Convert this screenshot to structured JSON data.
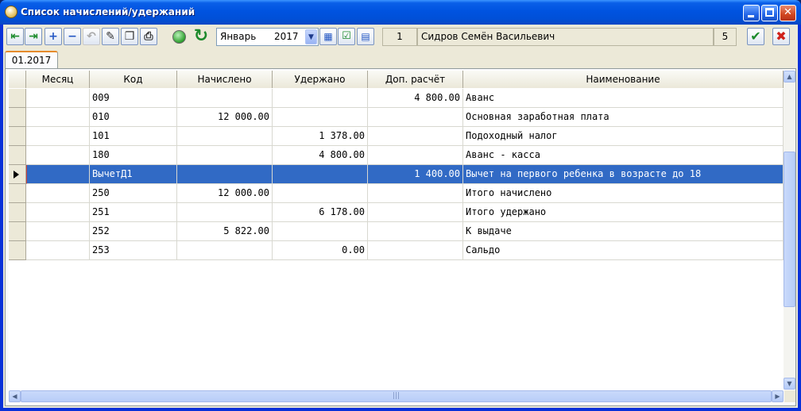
{
  "window": {
    "title": "Список начислений/удержаний"
  },
  "toolbar": {
    "period_month": "Январь",
    "period_year": "2017",
    "employee_number": "1",
    "employee_name": "Сидров Семён Васильевич",
    "employee_count": "5"
  },
  "tabs": [
    {
      "label": "01.2017"
    }
  ],
  "grid": {
    "columns": [
      "Месяц",
      "Код",
      "Начислено",
      "Удержано",
      "Доп. расчёт",
      "Наименование"
    ],
    "selected_row": 4,
    "rows": [
      {
        "month": "",
        "code": "009",
        "accrued": "",
        "withheld": "",
        "extra": "4 800.00",
        "name": "Аванс"
      },
      {
        "month": "",
        "code": "010",
        "accrued": "12 000.00",
        "withheld": "",
        "extra": "",
        "name": "Основная заработная плата"
      },
      {
        "month": "",
        "code": "101",
        "accrued": "",
        "withheld": "1 378.00",
        "extra": "",
        "name": "Подоходный налог"
      },
      {
        "month": "",
        "code": "180",
        "accrued": "",
        "withheld": "4 800.00",
        "extra": "",
        "name": "Аванс - касса"
      },
      {
        "month": "",
        "code": "ВычетД1",
        "accrued": "",
        "withheld": "",
        "extra": "1 400.00",
        "name": "Вычет на первого ребенка в возрасте до 18"
      },
      {
        "month": "",
        "code": "250",
        "accrued": "12 000.00",
        "withheld": "",
        "extra": "",
        "name": "Итого начислено"
      },
      {
        "month": "",
        "code": "251",
        "accrued": "",
        "withheld": "6 178.00",
        "extra": "",
        "name": "Итого удержано"
      },
      {
        "month": "",
        "code": "252",
        "accrued": "5 822.00",
        "withheld": "",
        "extra": "",
        "name": "К выдаче"
      },
      {
        "month": "",
        "code": "253",
        "accrued": "",
        "withheld": "0.00",
        "extra": "",
        "name": "Сальдо"
      }
    ]
  },
  "icons": {
    "first": "arrow-left-icon",
    "next": "arrow-right-icon",
    "add": "plus-icon",
    "remove": "minus-icon",
    "undo": "undo-icon",
    "edit": "pencil-icon",
    "copy": "copy-icon",
    "print": "printer-icon",
    "status": "green-circle-icon",
    "refresh": "refresh-icon",
    "calendar": "calendar-icon",
    "check": "checkbox-icon",
    "table": "table-icon",
    "ok": "checkmark-icon",
    "cancel": "red-x-icon"
  },
  "colors": {
    "title_bar": "#0053e0",
    "selection": "#316ac5",
    "ok_green": "#1a8a2a",
    "cancel_red": "#d0211b"
  }
}
